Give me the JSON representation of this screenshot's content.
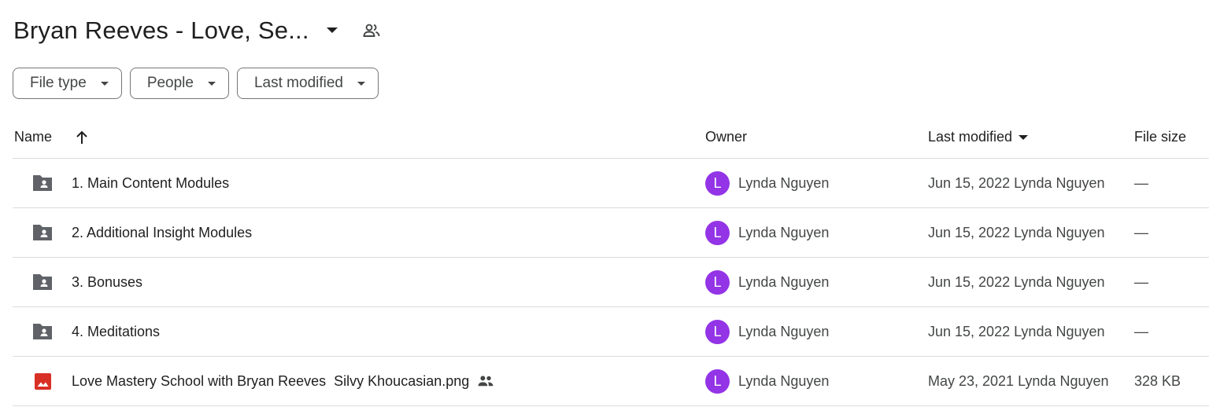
{
  "header": {
    "title": "Bryan Reeves - Love, Se...",
    "caret_icon": "arrow-drop-down-icon",
    "shared_icon": "people-icon"
  },
  "filters": [
    {
      "label": "File type"
    },
    {
      "label": "People"
    },
    {
      "label": "Last modified"
    }
  ],
  "columns": {
    "name": "Name",
    "owner": "Owner",
    "last_modified": "Last modified",
    "file_size": "File size"
  },
  "rows": [
    {
      "icon": "shared-folder-icon",
      "name": "1. Main Content Modules",
      "owner_initial": "L",
      "owner": "Lynda Nguyen",
      "modified": "Jun 15, 2022 Lynda Nguyen",
      "size": "—"
    },
    {
      "icon": "shared-folder-icon",
      "name": "2. Additional Insight Modules",
      "owner_initial": "L",
      "owner": "Lynda Nguyen",
      "modified": "Jun 15, 2022 Lynda Nguyen",
      "size": "—"
    },
    {
      "icon": "shared-folder-icon",
      "name": "3. Bonuses",
      "owner_initial": "L",
      "owner": "Lynda Nguyen",
      "modified": "Jun 15, 2022 Lynda Nguyen",
      "size": "—"
    },
    {
      "icon": "shared-folder-icon",
      "name": "4. Meditations",
      "owner_initial": "L",
      "owner": "Lynda Nguyen",
      "modified": "Jun 15, 2022 Lynda Nguyen",
      "size": "—"
    },
    {
      "icon": "image-file-icon",
      "name": "Love Mastery School with Bryan Reeves  Silvy Khoucasian.png",
      "owner_initial": "L",
      "owner": "Lynda Nguyen",
      "modified": "May 23, 2021 Lynda Nguyen",
      "size": "328 KB"
    }
  ],
  "colors": {
    "avatar": "#9334e6",
    "folder": "#5f6368",
    "image": "#d93025",
    "border": "#dadce0"
  }
}
